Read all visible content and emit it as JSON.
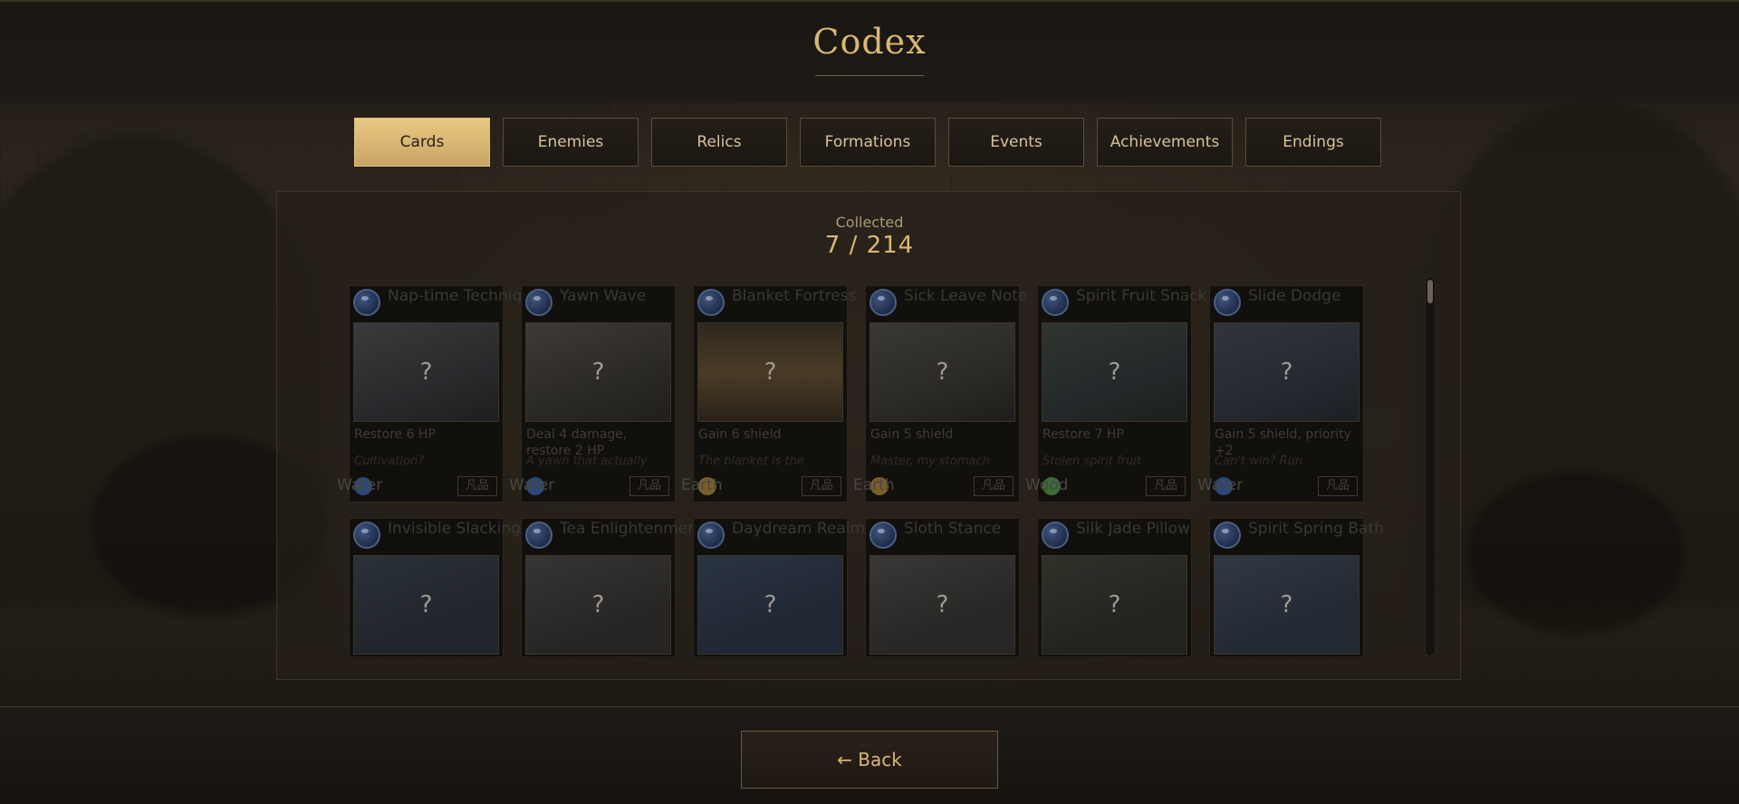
{
  "title": "Codex",
  "tabs": [
    {
      "label": "Cards",
      "active": true
    },
    {
      "label": "Enemies",
      "active": false
    },
    {
      "label": "Relics",
      "active": false
    },
    {
      "label": "Formations",
      "active": false
    },
    {
      "label": "Events",
      "active": false
    },
    {
      "label": "Achievements",
      "active": false
    },
    {
      "label": "Endings",
      "active": false
    }
  ],
  "collected": {
    "label": "Collected",
    "count": "7 / 214"
  },
  "cards": [
    {
      "name": "Nap-time Technique",
      "desc": "Restore 6 HP",
      "flavor": "Cultivation?",
      "element": "Water",
      "element_color": "#2c4777",
      "rarity": "凡品",
      "art_mark": "?"
    },
    {
      "name": "Yawn Wave",
      "desc": "Deal 4 damage, restore 2 HP",
      "flavor": "A yawn that actually",
      "element": "Water",
      "element_color": "#2c4777",
      "rarity": "凡品",
      "art_mark": "?"
    },
    {
      "name": "Blanket Fortress",
      "desc": "Gain 6 shield",
      "flavor": "The blanket is the",
      "element": "Earth",
      "element_color": "#7a5f2b",
      "rarity": "凡品",
      "art_mark": "?"
    },
    {
      "name": "Sick Leave Note",
      "desc": "Gain 5 shield",
      "flavor": "Master, my stomach",
      "element": "Earth",
      "element_color": "#7a5f2b",
      "rarity": "凡品",
      "art_mark": "?"
    },
    {
      "name": "Spirit Fruit Snack",
      "desc": "Restore 7 HP",
      "flavor": "Stolen spirit fruit",
      "element": "Wood",
      "element_color": "#3b6b37",
      "rarity": "凡品",
      "art_mark": "?"
    },
    {
      "name": "Slide Dodge",
      "desc": "Gain 5 shield, priority +2",
      "flavor": "Can't win? Run",
      "element": "Water",
      "element_color": "#2c4777",
      "rarity": "凡品",
      "art_mark": "?"
    },
    {
      "name": "Invisible Slacking",
      "desc": "",
      "flavor": "",
      "element": "",
      "element_color": "#2c4777",
      "rarity": "",
      "art_mark": "?"
    },
    {
      "name": "Tea Enlightenment",
      "desc": "",
      "flavor": "",
      "element": "",
      "element_color": "#2c4777",
      "rarity": "",
      "art_mark": "?"
    },
    {
      "name": "Daydream Realm",
      "desc": "",
      "flavor": "",
      "element": "",
      "element_color": "#2c4777",
      "rarity": "",
      "art_mark": "?"
    },
    {
      "name": "Sloth Stance",
      "desc": "",
      "flavor": "",
      "element": "",
      "element_color": "#2c4777",
      "rarity": "",
      "art_mark": "?"
    },
    {
      "name": "Silk Jade Pillow",
      "desc": "",
      "flavor": "",
      "element": "",
      "element_color": "#2c4777",
      "rarity": "",
      "art_mark": "?"
    },
    {
      "name": "Spirit Spring Bath",
      "desc": "",
      "flavor": "",
      "element": "",
      "element_color": "#2c4777",
      "rarity": "",
      "art_mark": "?"
    }
  ],
  "back_label": "← Back",
  "colors": {
    "accent": "#d9b874",
    "active_tab": "#e8c983",
    "background": "#17130f"
  }
}
